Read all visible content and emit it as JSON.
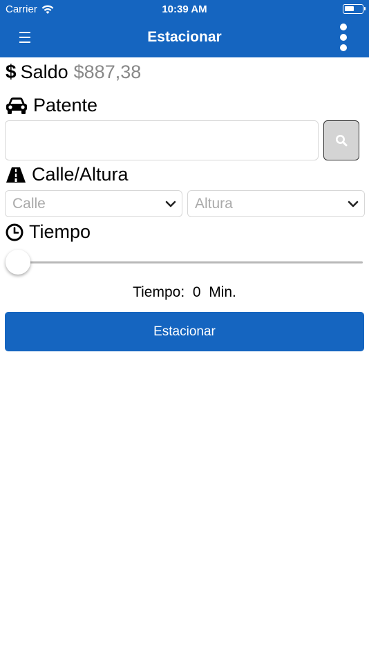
{
  "status_bar": {
    "carrier": "Carrier",
    "time": "10:39 AM",
    "battery_level": 0.55
  },
  "nav": {
    "title": "Estacionar",
    "menu_icon": "hamburger-icon",
    "more_icon": "more-vertical-icon"
  },
  "saldo": {
    "label": "Saldo",
    "amount": "$887,38",
    "icon": "dollar-icon"
  },
  "patente": {
    "label": "Patente",
    "icon": "car-icon",
    "input_value": "",
    "input_placeholder": "",
    "search_icon": "search-icon"
  },
  "calle_altura": {
    "label": "Calle/Altura",
    "icon": "road-icon",
    "calle_placeholder": "Calle",
    "altura_placeholder": "Altura"
  },
  "tiempo": {
    "label": "Tiempo",
    "icon": "clock-icon",
    "slider_value": 0,
    "readout_prefix": "Tiempo:",
    "readout_value": "0",
    "readout_unit": "Min."
  },
  "actions": {
    "park_label": "Estacionar"
  },
  "colors": {
    "primary": "#1565c0",
    "muted_text": "#888888",
    "placeholder": "#aaaaaa"
  }
}
